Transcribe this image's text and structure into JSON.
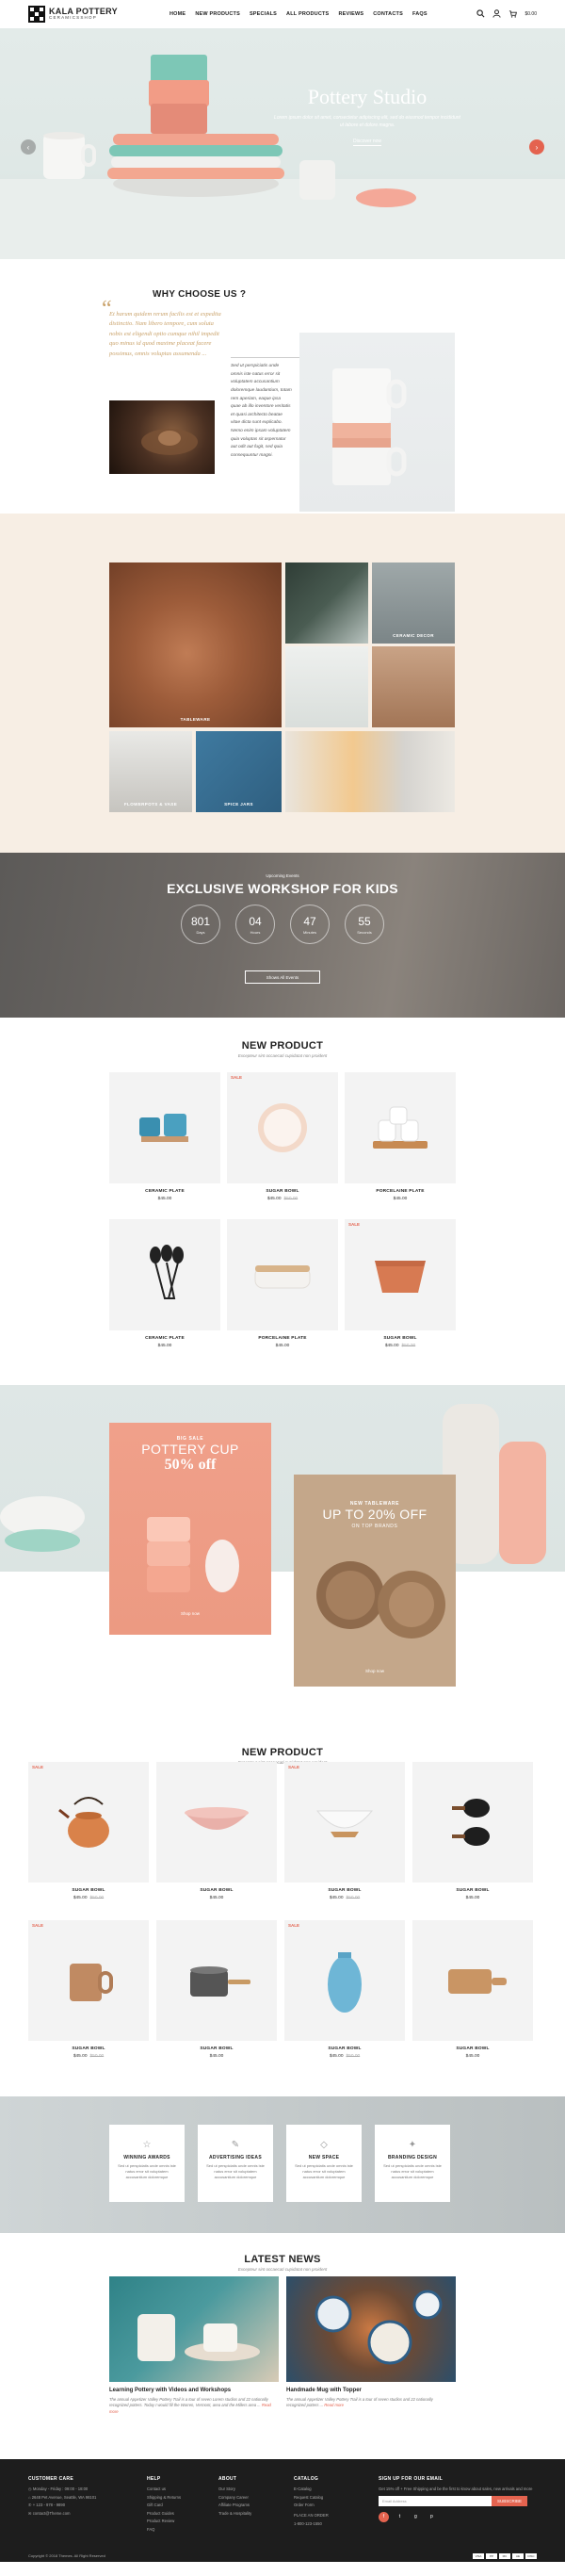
{
  "header": {
    "brand": "KALA POTTERY",
    "brand_sub": "CERAMICSSHOP",
    "nav": [
      "HOME",
      "NEW PRODUCTS",
      "SPECIALS",
      "ALL PRODUCTS",
      "REVIEWS",
      "CONTACTS",
      "FAQS"
    ],
    "cart_label": "$0.00"
  },
  "hero": {
    "title": "Pottery Studio",
    "text": "Lorem ipsum dolor sit amet, consectetur adipiscing elit, sed do eiusmod tempor incididunt ut labore et dolore magna.",
    "button": "Discover now"
  },
  "why": {
    "title": "WHY CHOOSE US ?",
    "quote": "Et harum quidem rerum facilis est et expedita distinctio. Nam libero tempore, cum soluta nobis est eligendi optio cumque nihil impedit quo minus id quod maxime placeat facere possimus, omnis voluptas assumenda ...",
    "text": "Sed ut perspiciatis unde omnis iste natus error sit voluptatem accusantium doloremque laudantium, totam rem aperiam, eaque ipsa quae ab illo inventore veritatis et quasi architecto beatae vitae dicta sunt explicabo. Nemo enim ipsam voluptatem quia voluptas sit aspernatur aut odit aut fugit, sed quia consequuntur magni."
  },
  "gallery": {
    "labels": [
      "TABLEWARE",
      "CERAMIC DECOR",
      "FLOWERPOTS & VASE",
      "SPICE JARS"
    ]
  },
  "workshop": {
    "kicker": "Upcoming Events",
    "title": "EXCLUSIVE WORKSHOP FOR KIDS",
    "timers": [
      {
        "value": "801",
        "unit": "Days"
      },
      {
        "value": "04",
        "unit": "Hours"
      },
      {
        "value": "47",
        "unit": "Minutes"
      },
      {
        "value": "55",
        "unit": "Seconds"
      }
    ],
    "button": "Shows All Events"
  },
  "new_product_1": {
    "title": "NEW PRODUCT",
    "subtitle": "Excepteur sint occaecati cupidatat non proident",
    "sale_label": "SALE",
    "items": [
      {
        "name": "CERAMIC PLATE",
        "price": "$45.00",
        "old": ""
      },
      {
        "name": "SUGAR BOWL",
        "price": "$45.00",
        "old": "$50.00"
      },
      {
        "name": "PORCELAINE PLATE",
        "price": "$45.00",
        "old": ""
      },
      {
        "name": "CERAMIC PLATE",
        "price": "$45.00",
        "old": ""
      },
      {
        "name": "PORCELAINE PLATE",
        "price": "$45.00",
        "old": ""
      },
      {
        "name": "SUGAR BOWL",
        "price": "$45.00",
        "old": "$50.00"
      }
    ]
  },
  "banners": {
    "b1_kicker": "BIG SALE",
    "b1_title": "POTTERY CUP",
    "b1_off": "50% off",
    "b1_shop": "Shop now",
    "b2_kicker": "NEW TABLEWARE",
    "b2_title": "UP TO 20% OFF",
    "b2_sub": "ON TOP BRANDS",
    "b2_shop": "Shop now"
  },
  "new_product_2": {
    "title": "NEW PRODUCT",
    "subtitle": "Excepteur sint occaecati cupidatat non proident",
    "sale_label": "SALE",
    "items": [
      {
        "name": "SUGAR BOWL",
        "price": "$45.00",
        "old": "$50.00"
      },
      {
        "name": "SUGAR BOWL",
        "price": "$45.00",
        "old": ""
      },
      {
        "name": "SUGAR BOWL",
        "price": "$45.00",
        "old": "$50.00"
      },
      {
        "name": "SUGAR BOWL",
        "price": "$45.00",
        "old": ""
      },
      {
        "name": "SUGAR BOWL",
        "price": "$45.00",
        "old": "$50.00"
      },
      {
        "name": "SUGAR BOWL",
        "price": "$45.00",
        "old": ""
      },
      {
        "name": "SUGAR BOWL",
        "price": "$45.00",
        "old": "$50.00"
      },
      {
        "name": "SUGAR BOWL",
        "price": "$45.00",
        "old": ""
      }
    ]
  },
  "features": [
    {
      "title": "WINNING AWARDS",
      "text": "Sed ut perspiciatis unde omnis iste natus error sit voluptatem accusantium doloremque"
    },
    {
      "title": "ADVERTISING IDEAS",
      "text": "Sed ut perspiciatis unde omnis iste natus error sit voluptatem accusantium doloremque"
    },
    {
      "title": "NEW SPACE",
      "text": "Sed ut perspiciatis unde omnis iste natus error sit voluptatem accusantium doloremque"
    },
    {
      "title": "BRANDING DESIGN",
      "text": "Sed ut perspiciatis unde omnis iste natus error sit voluptatem accusantium doloremque"
    }
  ],
  "news": {
    "title": "LATEST NEWS",
    "subtitle": "Excepteur sint occaecati cupidatat non proident",
    "items": [
      {
        "title": "Learning Pottery with Videos and Workshops",
        "text": "The annual Appetizer Valley Pottery Trail is a tour of seven Lorem studios and 22 nationally recognized potters. Today I would fill the Warren, Vermont, area and the Millers area ...",
        "more": "Read more"
      },
      {
        "title": "Handmade Mug with Topper",
        "text": "The annual Appetizer Valley Pottery Trail is a tour of seven studios and 22 nationally recognized potters ...",
        "more": "Read more"
      }
    ]
  },
  "footer": {
    "care_head": "CUSTOMER CARE",
    "care": [
      "Monday - Friday : 09:00 - 18:00",
      "2648 Pet Avenue, Seattle, WA 98101",
      "+ 123 - 978 - 9890",
      "contact@Theme.com"
    ],
    "help_head": "HELP",
    "help": [
      "Contact us",
      "Shipping & Returns",
      "Gift Card",
      "Product Guides",
      "Product Review",
      "FAQ"
    ],
    "about_head": "ABOUT",
    "about": [
      "Our Story",
      "Company Career",
      "Affiliate Programs",
      "Trade & Hospitality"
    ],
    "catalog_head": "CATALOG",
    "catalog": [
      "E-Catalog",
      "Request Catalog",
      "Order Form",
      "PLACE AN ORDER",
      "1-800-123-1550"
    ],
    "signup_head": "SIGN UP FOR OUR EMAIL",
    "signup_text": "Get 15% off + Free Shipping and be the first to know about sales, new arrivals and more",
    "email_placeholder": "Email Address",
    "subscribe": "SUBSCRIBE",
    "copyright": "Copyright © 2018 Themes. All Right Reserved",
    "payments": [
      "VISA",
      "PP",
      "MC",
      "AE",
      "DISC"
    ]
  }
}
